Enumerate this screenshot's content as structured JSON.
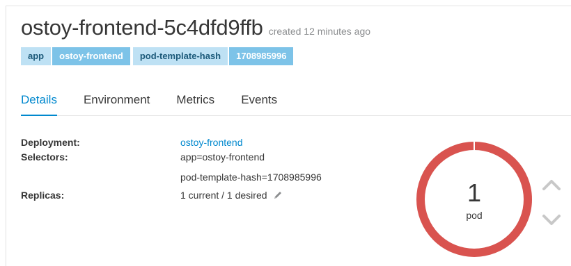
{
  "header": {
    "title": "ostoy-frontend-5c4dfd9ffb",
    "created": "created 12 minutes ago"
  },
  "labels": [
    {
      "key": "app",
      "value": "ostoy-frontend"
    },
    {
      "key": "pod-template-hash",
      "value": "1708985996"
    }
  ],
  "tabs": [
    "Details",
    "Environment",
    "Metrics",
    "Events"
  ],
  "active_tab": "Details",
  "details": {
    "deployment_label": "Deployment:",
    "deployment_value": "ostoy-frontend",
    "selectors_label": "Selectors:",
    "selectors_values": [
      "app=ostoy-frontend",
      "pod-template-hash=1708985996"
    ],
    "replicas_label": "Replicas:",
    "replicas_value": "1 current / 1 desired"
  },
  "pod_donut": {
    "count": "1",
    "unit": "pod",
    "ring_color": "#d9534f",
    "fill_fraction": 1.0
  },
  "scale_controls": {
    "up_icon": "chevron-up-icon",
    "down_icon": "chevron-down-icon"
  },
  "colors": {
    "accent": "#0088ce",
    "label_key_bg": "#bee1f4",
    "label_value_bg": "#7dc3e8"
  }
}
